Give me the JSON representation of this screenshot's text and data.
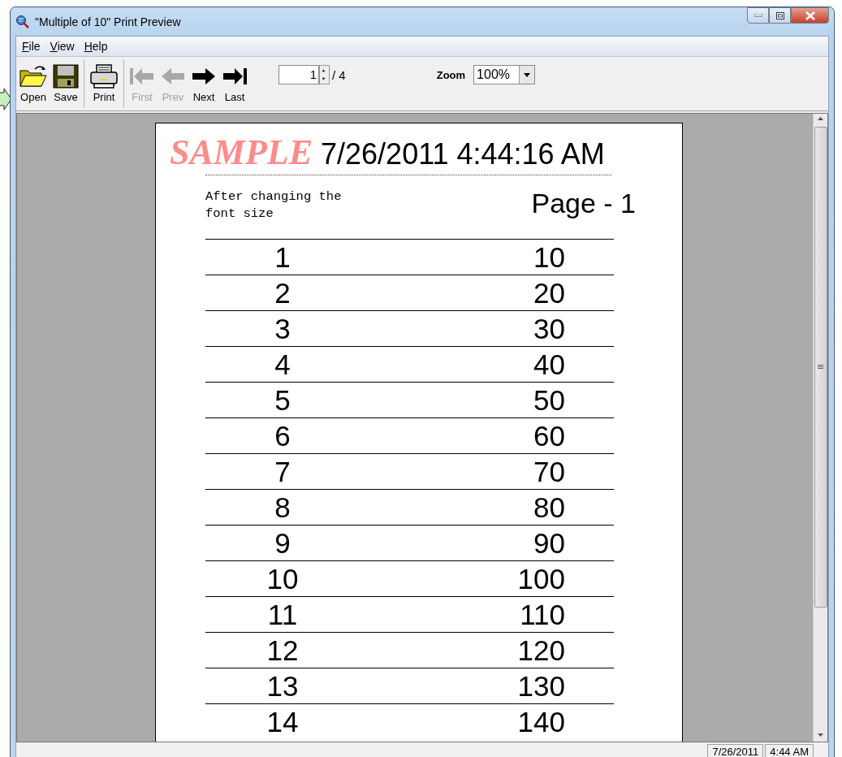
{
  "window": {
    "title": "\"Multiple of 10\" Print Preview"
  },
  "menu": [
    {
      "label": "File"
    },
    {
      "label": "View"
    },
    {
      "label": "Help"
    }
  ],
  "toolbar": {
    "buttons": [
      {
        "label": "Open",
        "kind": "open",
        "disabled": false,
        "separator_after": false
      },
      {
        "label": "Save",
        "kind": "save",
        "disabled": false,
        "separator_after": true
      },
      {
        "label": "Print",
        "kind": "print",
        "disabled": false,
        "separator_after": true
      },
      {
        "label": "First",
        "kind": "first",
        "disabled": true,
        "separator_after": false
      },
      {
        "label": "Prev",
        "kind": "prev",
        "disabled": true,
        "separator_after": false
      },
      {
        "label": "Next",
        "kind": "next",
        "disabled": false,
        "separator_after": false
      },
      {
        "label": "Last",
        "kind": "last",
        "disabled": false,
        "separator_after": false
      }
    ],
    "page_field": {
      "value": "1",
      "total": "/ 4"
    },
    "zoom": {
      "label": "Zoom",
      "value": "100%"
    }
  },
  "preview": {
    "watermark": "SAMPLE",
    "timestamp": "7/26/2011 4:44:16 AM",
    "note": "After changing the font size",
    "page_label": "Page - 1",
    "rows": [
      [
        "1",
        "10"
      ],
      [
        "2",
        "20"
      ],
      [
        "3",
        "30"
      ],
      [
        "4",
        "40"
      ],
      [
        "5",
        "50"
      ],
      [
        "6",
        "60"
      ],
      [
        "7",
        "70"
      ],
      [
        "8",
        "80"
      ],
      [
        "9",
        "90"
      ],
      [
        "10",
        "100"
      ],
      [
        "11",
        "110"
      ],
      [
        "12",
        "120"
      ],
      [
        "13",
        "130"
      ],
      [
        "14",
        "140"
      ]
    ]
  },
  "status_bar": {
    "date": "7/26/2011",
    "time": "4:44 AM"
  }
}
